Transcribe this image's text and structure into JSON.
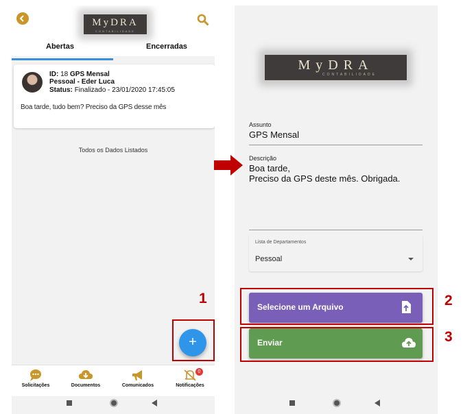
{
  "colors": {
    "accent_gold": "#c9962a",
    "tab_indicator": "#3b8fd9",
    "fab": "#2f95e8",
    "select_file_button": "#7a5fb8",
    "send_button": "#5f9b50",
    "annotation_red": "#c00000"
  },
  "left_screen": {
    "header": {
      "back_icon": "back-arrow-icon",
      "logo_text": "MyDRA",
      "logo_subtext": "CONTABILIDADE",
      "search_icon": "search-icon"
    },
    "tabs": [
      {
        "label": "Abertas",
        "active": true
      },
      {
        "label": "Encerradas",
        "active": false
      }
    ],
    "ticket": {
      "id_label": "ID:",
      "id_value": "18",
      "title": "GPS Mensal",
      "department_line": "Pessoal - Eder Luca",
      "status_label": "Status:",
      "status_value": "Finalizado - 23/01/2020 17:45:05",
      "message": "Boa tarde, tudo bem? Preciso da GPS desse mês"
    },
    "list_footer": "Todos os Dados Listados",
    "fab_label": "+",
    "bottom_nav": [
      {
        "label": "Solicitações",
        "icon": "chat-bubble-icon"
      },
      {
        "label": "Documentos",
        "icon": "cloud-download-icon"
      },
      {
        "label": "Comunicados",
        "icon": "megaphone-icon"
      },
      {
        "label": "Notificações",
        "icon": "bell-off-icon",
        "badge": "0"
      }
    ]
  },
  "right_screen": {
    "logo_text": "MyDRA",
    "logo_subtext": "CONTABILIDADE",
    "assunto": {
      "label": "Assunto",
      "value": "GPS Mensal"
    },
    "descricao": {
      "label": "Descrição",
      "line1": "Boa tarde,",
      "line2": "Preciso da GPS deste mês. Obrigada."
    },
    "departamentos": {
      "label": "Lista de Departamentos",
      "value": "Pessoal"
    },
    "select_file_button": {
      "label": "Selecione um Arquivo",
      "icon": "file-upload-icon"
    },
    "send_button": {
      "label": "Enviar",
      "icon": "cloud-upload-icon"
    }
  },
  "annotations": {
    "step1": "1",
    "step2": "2",
    "step3": "3"
  }
}
